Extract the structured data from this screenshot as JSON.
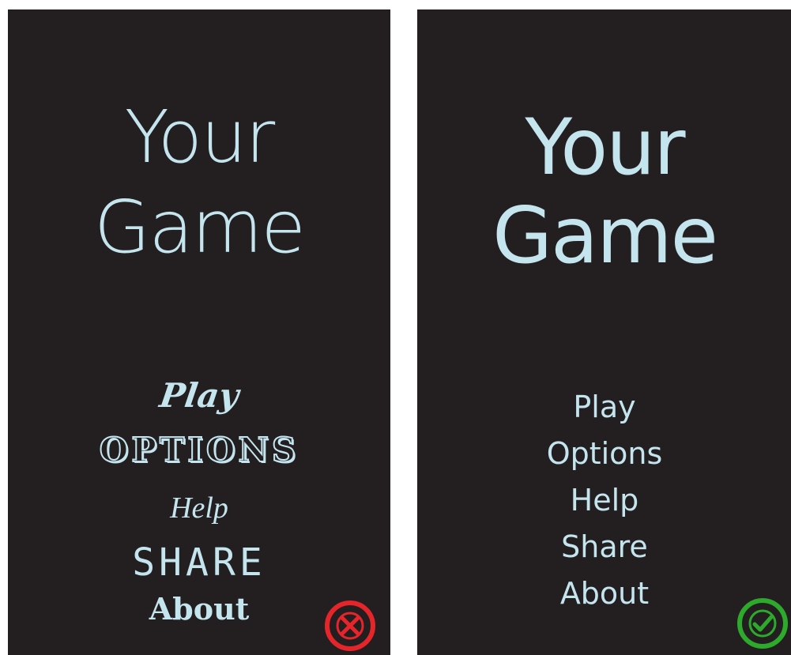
{
  "colors": {
    "screen_background": "#231f20",
    "text": "#c4e4ee",
    "wrong_mark": "#e5252a",
    "right_mark": "#2da92c",
    "page_background": "#ffffff"
  },
  "screens": [
    {
      "verdict": "incorrect",
      "title": [
        "Your",
        "Game"
      ],
      "menu": [
        "Play",
        "OPTIONS",
        "Help",
        "SHARE",
        "About"
      ],
      "badge_icon": "cross-circle-icon"
    },
    {
      "verdict": "correct",
      "title": [
        "Your",
        "Game"
      ],
      "menu": [
        "Play",
        "Options",
        "Help",
        "Share",
        "About"
      ],
      "badge_icon": "check-circle-icon"
    }
  ]
}
